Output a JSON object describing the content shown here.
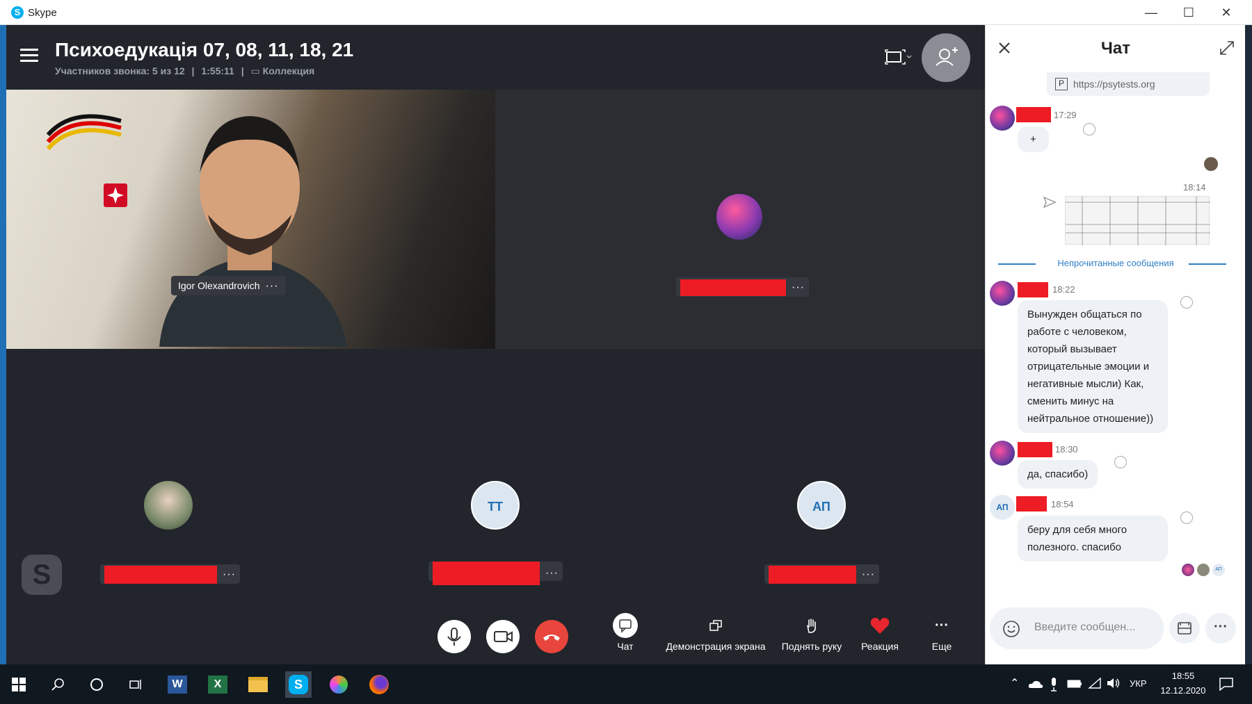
{
  "window": {
    "title": "Skype"
  },
  "call": {
    "title": "Психоедукація 07, 08, 11, 18, 21",
    "participants": "Участников звонка: 5 из 12",
    "duration": "1:55:11",
    "collection": "Коллекция"
  },
  "tiles": {
    "video_name": "Igor Olexandrovich",
    "initials_tt": "ТТ",
    "initials_ap": "АП"
  },
  "controls": {
    "chat": "Чат",
    "screen_share": "Демонстрация экрана",
    "raise_hand": "Поднять руку",
    "reaction": "Реакция",
    "more": "Еще"
  },
  "chat": {
    "title": "Чат",
    "link": "https://psytests.org",
    "unread_label": "Непрочитанные сообщения",
    "messages": [
      {
        "time": "17:29",
        "text": "+"
      },
      {
        "time": "18:14",
        "text": ""
      },
      {
        "time": "18:22",
        "text": "Вынужден общаться по работе с человеком, который вызывает отрицательные эмоции и негативные мысли) Как, сменить минус на нейтральное отношение))"
      },
      {
        "time": "18:30",
        "text": "да, спасибо)"
      },
      {
        "time": "18:54",
        "text": "беру для себя много полезного. спасибо"
      }
    ],
    "ap_initials": "АП",
    "input_placeholder": "Введите сообщен..."
  },
  "taskbar": {
    "language": "УКР",
    "time": "18:55",
    "date": "12.12.2020"
  },
  "colors": {
    "accent": "#00aff0",
    "end_call": "#e8453c",
    "redaction": "#ee1c24",
    "link_blue": "#2e7fc5"
  }
}
